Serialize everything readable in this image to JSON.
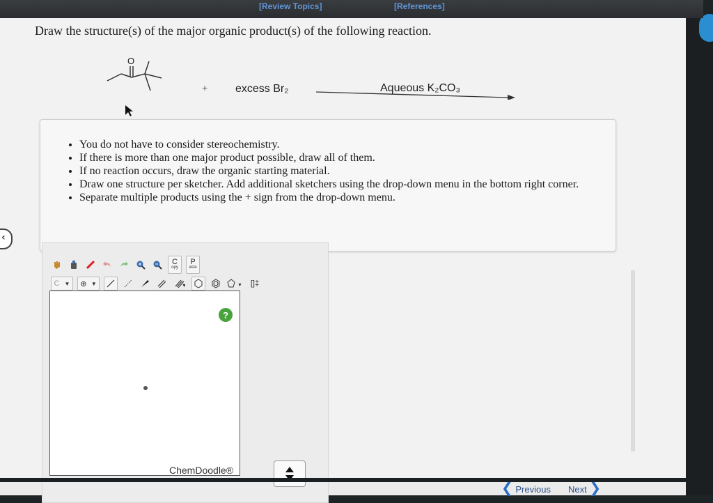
{
  "header": {
    "review_topics": "[Review Topics]",
    "references": "[References]"
  },
  "question": {
    "prompt": "Draw the structure(s) of the major organic product(s) of the following reaction."
  },
  "reaction": {
    "plus": "+",
    "reagent": "excess Br₂",
    "conditions": "Aqueous K₂CO₃",
    "oxygen_label": "O"
  },
  "instructions": [
    "You do not have to consider stereochemistry.",
    "If there is more than one major product possible, draw all of them.",
    "If no reaction occurs, draw the organic starting material.",
    "Draw one structure per sketcher. Add additional sketchers using the drop-down menu in the bottom right corner.",
    "Separate multiple products using the + sign from the drop-down menu."
  ],
  "sketcher": {
    "copy_label": "C",
    "copy_sub": "opy",
    "paste_label": "P",
    "paste_sub": "aste",
    "element_label": "C",
    "charge_label": "⊕",
    "bracket_label": "[]‡",
    "help_label": "?",
    "brand": "ChemDoodle®"
  },
  "navigation": {
    "previous": "Previous",
    "next": "Next"
  },
  "colors": {
    "link_blue": "#5f95d8",
    "help_green": "#49a33d",
    "nav_blue": "#2b6fc2"
  }
}
